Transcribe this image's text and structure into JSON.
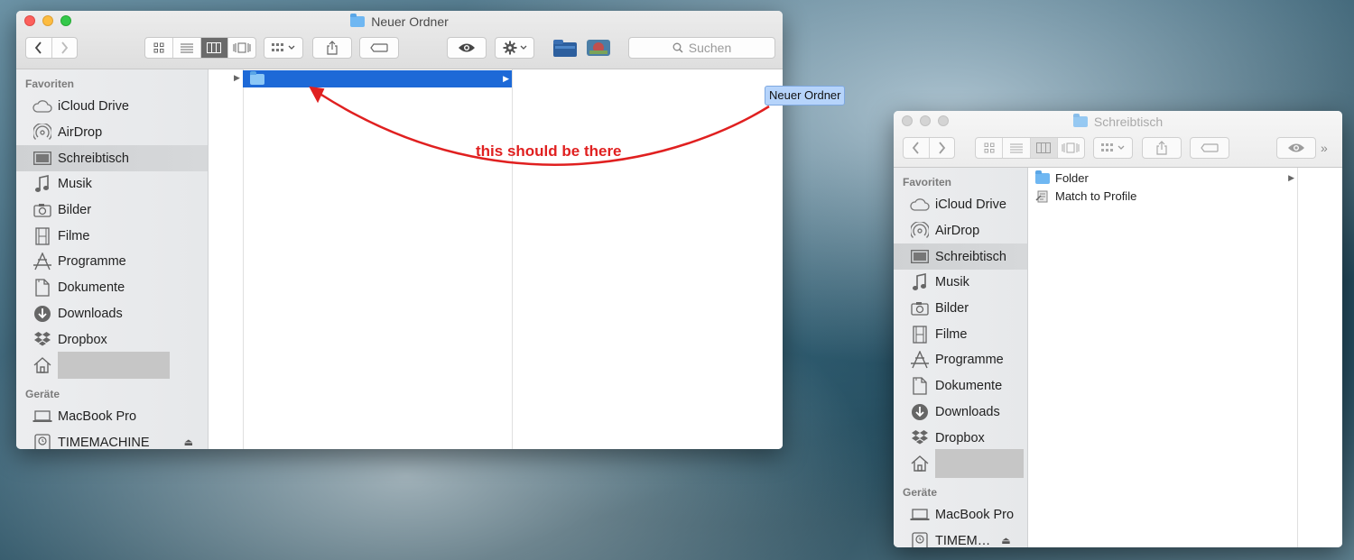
{
  "window1": {
    "title": "Neuer Ordner",
    "search_placeholder": "Suchen",
    "sidebar": {
      "favorites_header": "Favoriten",
      "items": [
        {
          "label": "iCloud Drive",
          "icon": "cloud-icon"
        },
        {
          "label": "AirDrop",
          "icon": "airdrop-icon"
        },
        {
          "label": "Schreibtisch",
          "icon": "desktop-icon",
          "selected": true
        },
        {
          "label": "Musik",
          "icon": "music-note-icon"
        },
        {
          "label": "Bilder",
          "icon": "camera-icon"
        },
        {
          "label": "Filme",
          "icon": "film-icon"
        },
        {
          "label": "Programme",
          "icon": "apps-icon"
        },
        {
          "label": "Dokumente",
          "icon": "document-icon"
        },
        {
          "label": "Downloads",
          "icon": "download-icon"
        },
        {
          "label": "Dropbox",
          "icon": "dropbox-icon"
        }
      ],
      "devices_header": "Geräte",
      "devices": [
        {
          "label": "MacBook Pro",
          "icon": "laptop-icon"
        },
        {
          "label": "TIMEMACHINE",
          "icon": "timemachine-icon"
        }
      ]
    }
  },
  "window2": {
    "title": "Schreibtisch",
    "sidebar": {
      "favorites_header": "Favoriten",
      "items": [
        {
          "label": "iCloud Drive",
          "icon": "cloud-icon"
        },
        {
          "label": "AirDrop",
          "icon": "airdrop-icon"
        },
        {
          "label": "Schreibtisch",
          "icon": "desktop-icon",
          "selected": true
        },
        {
          "label": "Musik",
          "icon": "music-note-icon"
        },
        {
          "label": "Bilder",
          "icon": "camera-icon"
        },
        {
          "label": "Filme",
          "icon": "film-icon"
        },
        {
          "label": "Programme",
          "icon": "apps-icon"
        },
        {
          "label": "Dokumente",
          "icon": "document-icon"
        },
        {
          "label": "Downloads",
          "icon": "download-icon"
        },
        {
          "label": "Dropbox",
          "icon": "dropbox-icon"
        }
      ],
      "devices_header": "Geräte",
      "devices": [
        {
          "label": "MacBook Pro",
          "icon": "laptop-icon"
        },
        {
          "label": "TIMEM…",
          "icon": "timemachine-icon"
        }
      ]
    },
    "files": [
      {
        "name": "Folder",
        "icon": "folder-icon"
      },
      {
        "name": "Match to Profile",
        "icon": "script-icon"
      }
    ]
  },
  "drag_label": "Neuer Ordner",
  "annotation_text": "this should be there",
  "colors": {
    "selection": "#1d69d7",
    "annotation": "#e02020",
    "folder": "#6fb7f2"
  }
}
